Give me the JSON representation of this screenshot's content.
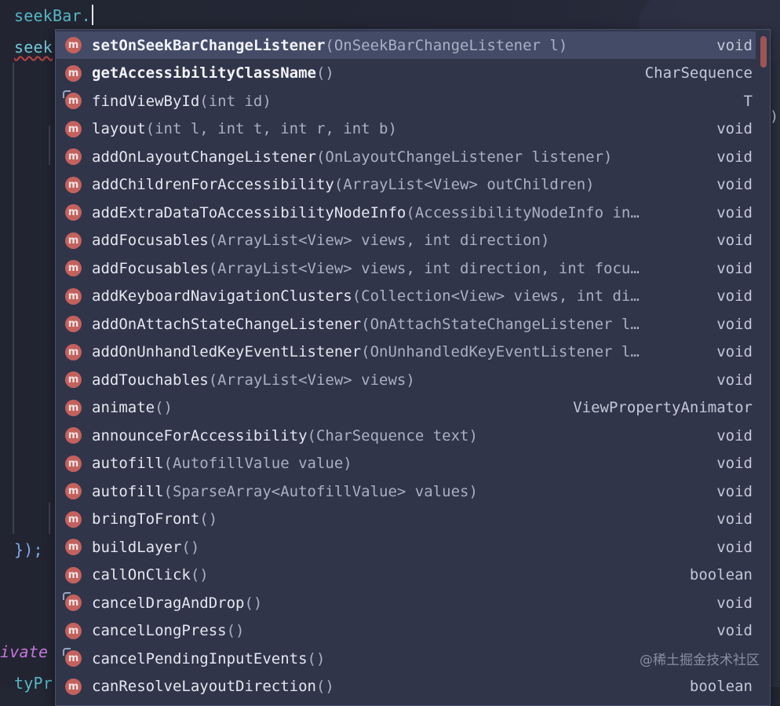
{
  "editor": {
    "line1": "seekBar.",
    "line2": "seek",
    "line3": "});",
    "line4": "ivate",
    "line5": "tyPr",
    "right_mark": ")"
  },
  "completion": {
    "items": [
      {
        "name": "setOnSeekBarChangeListener",
        "params": "(OnSeekBarChangeListener l)",
        "type": "void",
        "icon": "method-icon"
      },
      {
        "name": "getAccessibilityClassName",
        "params": "()",
        "type": "CharSequence",
        "icon": "method-icon"
      },
      {
        "name": "findViewById",
        "params": "(int id)",
        "type": "T",
        "icon": "method-override-icon"
      },
      {
        "name": "layout",
        "params": "(int l, int t, int r, int b)",
        "type": "void",
        "icon": "method-icon"
      },
      {
        "name": "addOnLayoutChangeListener",
        "params": "(OnLayoutChangeListener listener)",
        "type": "void",
        "icon": "method-icon"
      },
      {
        "name": "addChildrenForAccessibility",
        "params": "(ArrayList<View> outChildren)",
        "type": "void",
        "icon": "method-icon"
      },
      {
        "name": "addExtraDataToAccessibilityNodeInfo",
        "params": "(AccessibilityNodeInfo in…",
        "type": "void",
        "icon": "method-icon"
      },
      {
        "name": "addFocusables",
        "params": "(ArrayList<View> views, int direction)",
        "type": "void",
        "icon": "method-icon"
      },
      {
        "name": "addFocusables",
        "params": "(ArrayList<View> views, int direction, int focu…",
        "type": "void",
        "icon": "method-icon"
      },
      {
        "name": "addKeyboardNavigationClusters",
        "params": "(Collection<View> views, int di…",
        "type": "void",
        "icon": "method-icon"
      },
      {
        "name": "addOnAttachStateChangeListener",
        "params": "(OnAttachStateChangeListener l…",
        "type": "void",
        "icon": "method-icon"
      },
      {
        "name": "addOnUnhandledKeyEventListener",
        "params": "(OnUnhandledKeyEventListener l…",
        "type": "void",
        "icon": "method-icon"
      },
      {
        "name": "addTouchables",
        "params": "(ArrayList<View> views)",
        "type": "void",
        "icon": "method-icon"
      },
      {
        "name": "animate",
        "params": "()",
        "type": "ViewPropertyAnimator",
        "icon": "method-icon"
      },
      {
        "name": "announceForAccessibility",
        "params": "(CharSequence text)",
        "type": "void",
        "icon": "method-icon"
      },
      {
        "name": "autofill",
        "params": "(AutofillValue value)",
        "type": "void",
        "icon": "method-icon"
      },
      {
        "name": "autofill",
        "params": "(SparseArray<AutofillValue> values)",
        "type": "void",
        "icon": "method-icon"
      },
      {
        "name": "bringToFront",
        "params": "()",
        "type": "void",
        "icon": "method-icon"
      },
      {
        "name": "buildLayer",
        "params": "()",
        "type": "void",
        "icon": "method-icon"
      },
      {
        "name": "callOnClick",
        "params": "()",
        "type": "boolean",
        "icon": "method-icon"
      },
      {
        "name": "cancelDragAndDrop",
        "params": "()",
        "type": "void",
        "icon": "method-override-icon"
      },
      {
        "name": "cancelLongPress",
        "params": "()",
        "type": "void",
        "icon": "method-icon"
      },
      {
        "name": "cancelPendingInputEvents",
        "params": "()",
        "type": "",
        "icon": "method-override-icon"
      },
      {
        "name": "canResolveLayoutDirection",
        "params": "()",
        "type": "boolean",
        "icon": "method-icon"
      }
    ],
    "icon_letter": "m"
  },
  "watermark": "@稀土掘金技术社区",
  "colors": {
    "popup_bg": "#30354a",
    "selected_row": "#434b67",
    "method_icon": "#c4615d",
    "keyword_cyan": "#56b6c2"
  }
}
